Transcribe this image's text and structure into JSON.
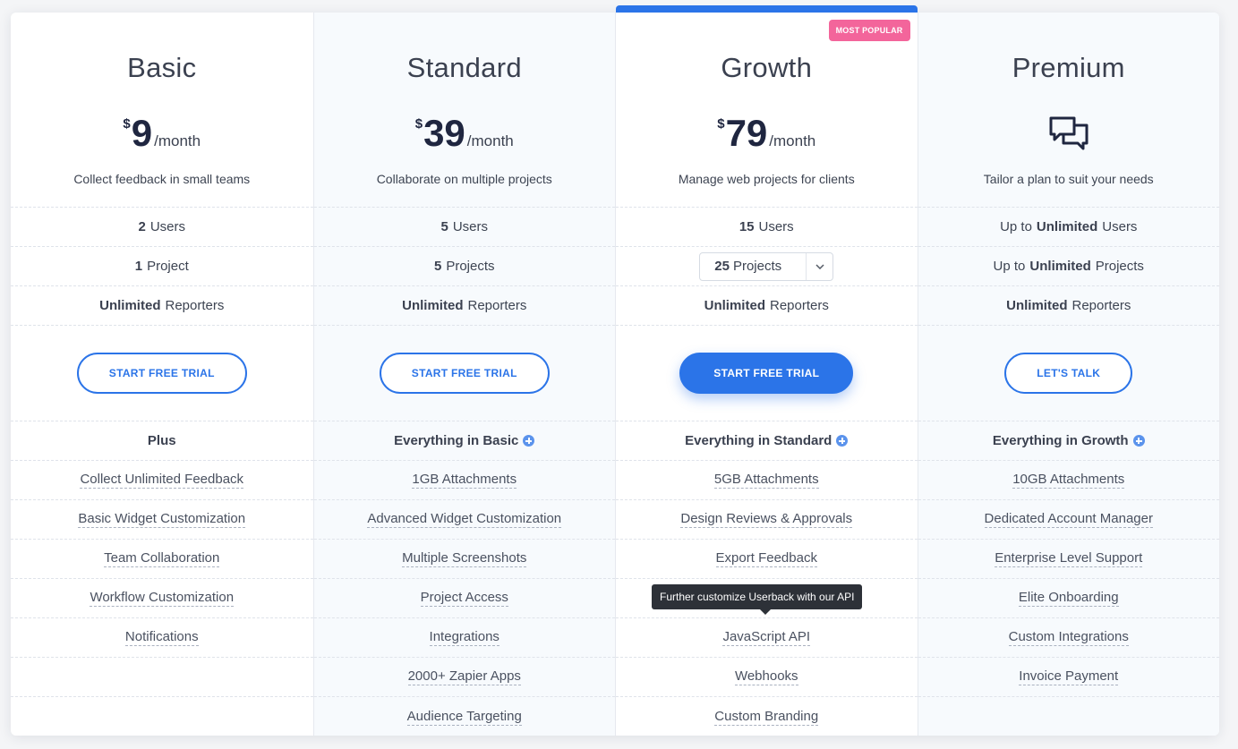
{
  "plans": [
    {
      "name": "Basic",
      "currency": "$",
      "amount": "9",
      "period": "/month",
      "tagline": "Collect feedback in small teams",
      "users": {
        "bold": "2",
        "rest": "Users"
      },
      "projects": {
        "bold": "1",
        "rest": "Project"
      },
      "reporters": {
        "bold": "Unlimited",
        "rest": "Reporters"
      },
      "cta": "START FREE TRIAL",
      "features_header": "Plus",
      "features": [
        "Collect Unlimited Feedback",
        "Basic Widget Customization",
        "Team Collaboration",
        "Workflow Customization",
        "Notifications"
      ]
    },
    {
      "name": "Standard",
      "currency": "$",
      "amount": "39",
      "period": "/month",
      "tagline": "Collaborate on multiple projects",
      "users": {
        "bold": "5",
        "rest": "Users"
      },
      "projects": {
        "bold": "5",
        "rest": "Projects"
      },
      "reporters": {
        "bold": "Unlimited",
        "rest": "Reporters"
      },
      "cta": "START FREE TRIAL",
      "features_header": "Everything in Basic",
      "features": [
        "1GB Attachments",
        "Advanced Widget Customization",
        "Multiple Screenshots",
        "Project Access",
        "Integrations",
        "2000+ Zapier Apps",
        "Audience Targeting"
      ]
    },
    {
      "name": "Growth",
      "badge": "MOST POPULAR",
      "currency": "$",
      "amount": "79",
      "period": "/month",
      "tagline": "Manage web projects for clients",
      "users": {
        "bold": "15",
        "rest": "Users"
      },
      "projects_select": {
        "bold": "25",
        "rest": "Projects"
      },
      "reporters": {
        "bold": "Unlimited",
        "rest": "Reporters"
      },
      "cta": "START FREE TRIAL",
      "features_header": "Everything in Standard",
      "features": [
        "5GB Attachments",
        "Design Reviews & Approvals",
        "Export Feedback",
        "Further customize Userback with our API",
        "JavaScript API",
        "Webhooks",
        "Custom Branding"
      ],
      "tooltip": "Further customize Userback with our API"
    },
    {
      "name": "Premium",
      "tagline": "Tailor a plan to suit your needs",
      "icon": "chat-bubbles-icon",
      "users": {
        "pre": "Up to",
        "bold": "Unlimited",
        "rest": "Users"
      },
      "projects": {
        "pre": "Up to",
        "bold": "Unlimited",
        "rest": "Projects"
      },
      "reporters": {
        "bold": "Unlimited",
        "rest": "Reporters"
      },
      "cta": "LET'S TALK",
      "features_header": "Everything in Growth",
      "features": [
        "10GB Attachments",
        "Dedicated Account Manager",
        "Enterprise Level Support",
        "Elite Onboarding",
        "Custom Integrations",
        "Invoice Payment"
      ]
    }
  ],
  "colors": {
    "accent": "#2b74e8",
    "badge": "#f3659b",
    "ink": "#1f2640"
  }
}
